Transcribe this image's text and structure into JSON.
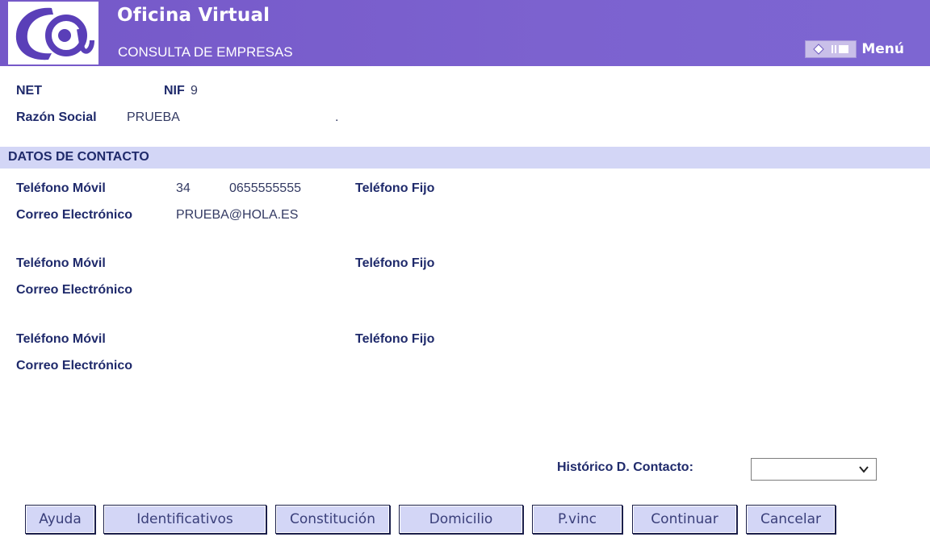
{
  "header": {
    "title": "Oficina Virtual",
    "subtitle": "CONSULTA DE EMPRESAS",
    "menu_label": "Menú",
    "logo_text": "C@"
  },
  "company": {
    "net_label": "NET",
    "nif_label": "NIF",
    "nif_value": "9",
    "razon_label": "Razón Social",
    "razon_value": "PRUEBA",
    "razon_trailing": "."
  },
  "section": {
    "title": "DATOS DE CONTACTO"
  },
  "contacts": [
    {
      "mobile_label": "Teléfono Móvil",
      "prefix": "34",
      "mobile_value": "0655555555",
      "landline_label": "Teléfono Fijo",
      "email_label": "Correo Electrónico",
      "email_value": "PRUEBA@HOLA.ES"
    },
    {
      "mobile_label": "Teléfono Móvil",
      "prefix": "",
      "mobile_value": "",
      "landline_label": "Teléfono Fijo",
      "email_label": "Correo Electrónico",
      "email_value": ""
    },
    {
      "mobile_label": "Teléfono Móvil",
      "prefix": "",
      "mobile_value": "",
      "landline_label": "Teléfono Fijo",
      "email_label": "Correo Electrónico",
      "email_value": ""
    }
  ],
  "history": {
    "label": "Histórico D. Contacto:",
    "selected": ""
  },
  "buttons": [
    "Ayuda",
    "Identificativos",
    "Constitución",
    "Domicilio",
    "P.vinc",
    "Continuar",
    "Cancelar"
  ],
  "colors": {
    "header": "#7a5fcc",
    "section_bar": "#d3d6f6",
    "label": "#1f2a6b",
    "button_bg": "#d3d6f6"
  }
}
